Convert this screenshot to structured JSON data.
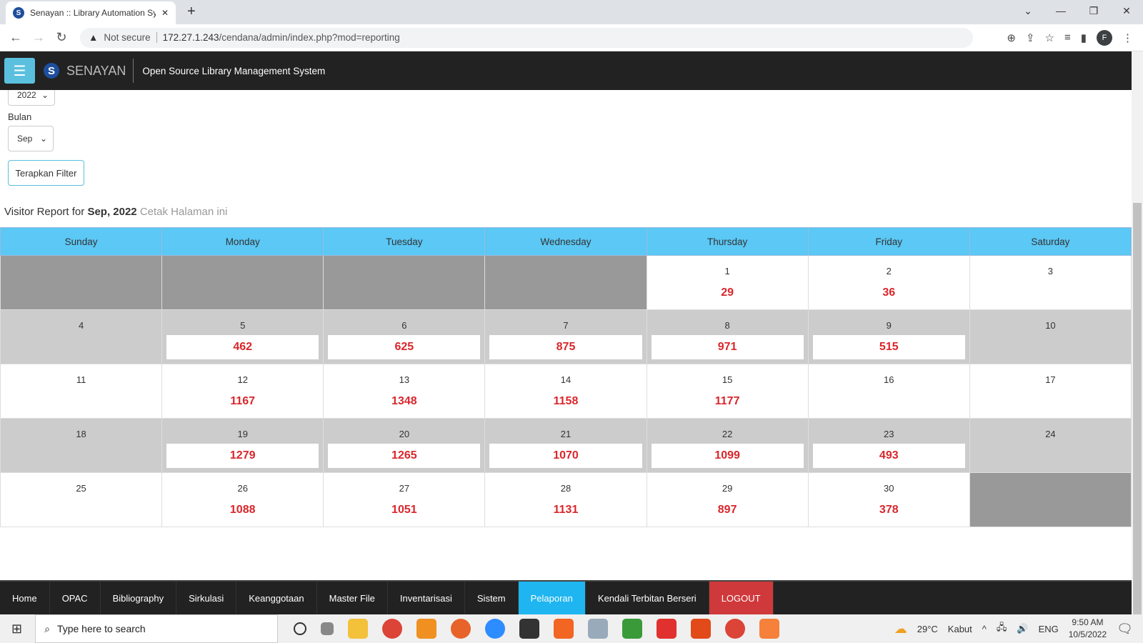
{
  "browser": {
    "tab_title": "Senayan :: Library Automation System",
    "not_secure": "Not secure",
    "url_host": "172.27.1.243",
    "url_path": "/cendana/admin/index.php?mod=reporting",
    "profile": "F"
  },
  "header": {
    "brand": "SENAYAN",
    "subtitle": "Open Source Library Management System"
  },
  "filters": {
    "year": "2022",
    "month_label": "Bulan",
    "month": "Sep",
    "apply": "Terapkan Filter"
  },
  "report": {
    "prefix": "Visitor Report for",
    "period": "Sep, 2022",
    "print": "Cetak Halaman ini"
  },
  "calendar": {
    "days": [
      "Sunday",
      "Monday",
      "Tuesday",
      "Wednesday",
      "Thursday",
      "Friday",
      "Saturday"
    ],
    "weeks": [
      [
        null,
        null,
        null,
        null,
        {
          "d": "1",
          "c": "29"
        },
        {
          "d": "2",
          "c": "36"
        },
        {
          "d": "3",
          "c": ""
        }
      ],
      [
        {
          "d": "4",
          "c": ""
        },
        {
          "d": "5",
          "c": "462"
        },
        {
          "d": "6",
          "c": "625"
        },
        {
          "d": "7",
          "c": "875"
        },
        {
          "d": "8",
          "c": "971"
        },
        {
          "d": "9",
          "c": "515"
        },
        {
          "d": "10",
          "c": ""
        }
      ],
      [
        {
          "d": "11",
          "c": ""
        },
        {
          "d": "12",
          "c": "1167"
        },
        {
          "d": "13",
          "c": "1348"
        },
        {
          "d": "14",
          "c": "1158"
        },
        {
          "d": "15",
          "c": "1177"
        },
        {
          "d": "16",
          "c": ""
        },
        {
          "d": "17",
          "c": ""
        }
      ],
      [
        {
          "d": "18",
          "c": ""
        },
        {
          "d": "19",
          "c": "1279"
        },
        {
          "d": "20",
          "c": "1265"
        },
        {
          "d": "21",
          "c": "1070"
        },
        {
          "d": "22",
          "c": "1099"
        },
        {
          "d": "23",
          "c": "493"
        },
        {
          "d": "24",
          "c": ""
        }
      ],
      [
        {
          "d": "25",
          "c": ""
        },
        {
          "d": "26",
          "c": "1088"
        },
        {
          "d": "27",
          "c": "1051"
        },
        {
          "d": "28",
          "c": "1131"
        },
        {
          "d": "29",
          "c": "897"
        },
        {
          "d": "30",
          "c": "378"
        },
        null
      ]
    ]
  },
  "bottom_nav": [
    "Home",
    "OPAC",
    "Bibliography",
    "Sirkulasi",
    "Keanggotaan",
    "Master File",
    "Inventarisasi",
    "Sistem",
    "Pelaporan",
    "Kendali Terbitan Berseri",
    "LOGOUT"
  ],
  "active_nav": "Pelaporan",
  "taskbar": {
    "search": "Type here to search",
    "weather": "29°C",
    "weather_desc": "Kabut",
    "lang": "ENG",
    "time": "9:50 AM",
    "date": "10/5/2022"
  },
  "colors": {
    "header_bg": "#5bc8f5",
    "count": "#d9262b",
    "active": "#1fb5f0",
    "logout": "#d0393b"
  }
}
